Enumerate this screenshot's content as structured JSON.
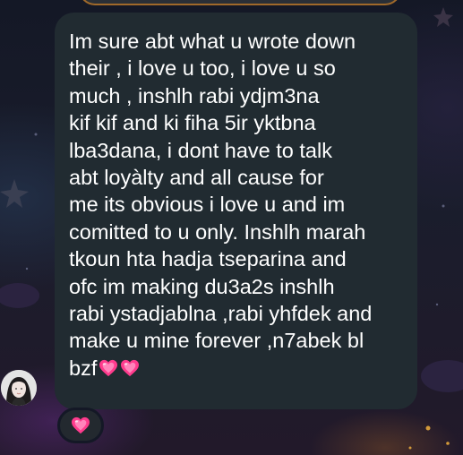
{
  "message": {
    "text": "Im sure abt what u wrote down\ntheir , i love u too, i love u so\nmuch , inshlh rabi ydjm3na\nkif kif and ki fiha 5ir yktbna\nlba3dana, i dont have to talk\nabt loyàlty and all cause for\nme its obvious i love u and im\ncomitted to u only. Inshlh marah\ntkoun hta hadja tseparina and\nofc im making du3a2s inshlh\nrabi ystadjablna ,rabi yhfdek and\nmake u mine forever ,n7abek bl\nbzf",
    "trailing_emoji": [
      "growing-heart-icon",
      "growing-heart-icon"
    ]
  },
  "reaction": {
    "emoji": "growing-heart-icon"
  },
  "colors": {
    "bubble_bg": "#212b31",
    "text": "#ffffff",
    "heart": "#ff3b8d",
    "top_bubble_border": "#a0692a"
  }
}
